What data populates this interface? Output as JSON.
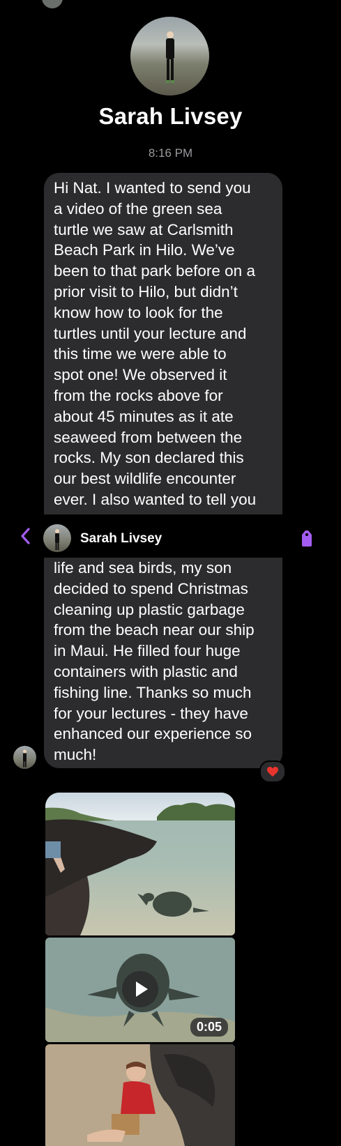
{
  "contact": {
    "name": "Sarah Livsey"
  },
  "timestamp": "8:16 PM",
  "message_top_lines": [
    "Hi Nat.  I wanted to send you",
    "a video of the green sea",
    "turtle we saw at Carlsmith",
    "Beach Park in Hilo.  We’ve",
    "been to that park before on a",
    "prior visit to Hilo, but didn’t",
    "know how to look for the",
    "turtles until your lecture and",
    "this time we were able to",
    "spot one!  We observed it",
    "from the rocks above for",
    "about 45 minutes as it ate",
    "seaweed from between the",
    "rocks.  My son declared this",
    "our best wildlife encounter",
    "ever.  I also wanted to tell you"
  ],
  "message_bottom_lines": [
    "life and sea birds, my son",
    "decided to spend Christmas",
    "cleaning up plastic garbage",
    "from the beach near our ship",
    "in Maui.  He filled four huge",
    "containers with plastic and",
    "fishing line.  Thanks so much",
    "for your lectures - they have",
    "enhanced our experience so",
    "much!"
  ],
  "reaction": "heart",
  "video": {
    "duration": "0:05"
  },
  "colors": {
    "accent": "#a35cf2",
    "bubble": "#2c2c2e",
    "reaction_heart": "#e8342c",
    "background": "#000000"
  },
  "icons": [
    "back-chevron-icon",
    "tag-icon",
    "heart-icon",
    "play-icon"
  ]
}
